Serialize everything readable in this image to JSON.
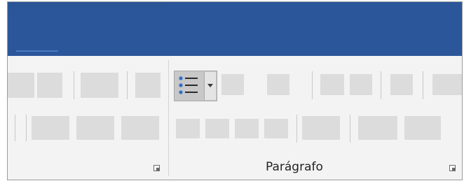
{
  "ribbon": {
    "paragraph_group": {
      "label": "Parágrafo",
      "bullets_icon": "bulleted-list-icon",
      "dropdown_icon": "chevron-down-icon",
      "launcher_icon": "dialog-launcher-icon"
    },
    "font_group": {
      "launcher_icon": "dialog-launcher-icon"
    }
  },
  "colors": {
    "title_bar": "#2b579a",
    "ribbon_background": "#f3f3f3",
    "placeholder_button": "#dcdcdc",
    "selected_button": "#c8c8c8",
    "bullet_blue": "#2f6fc7"
  }
}
